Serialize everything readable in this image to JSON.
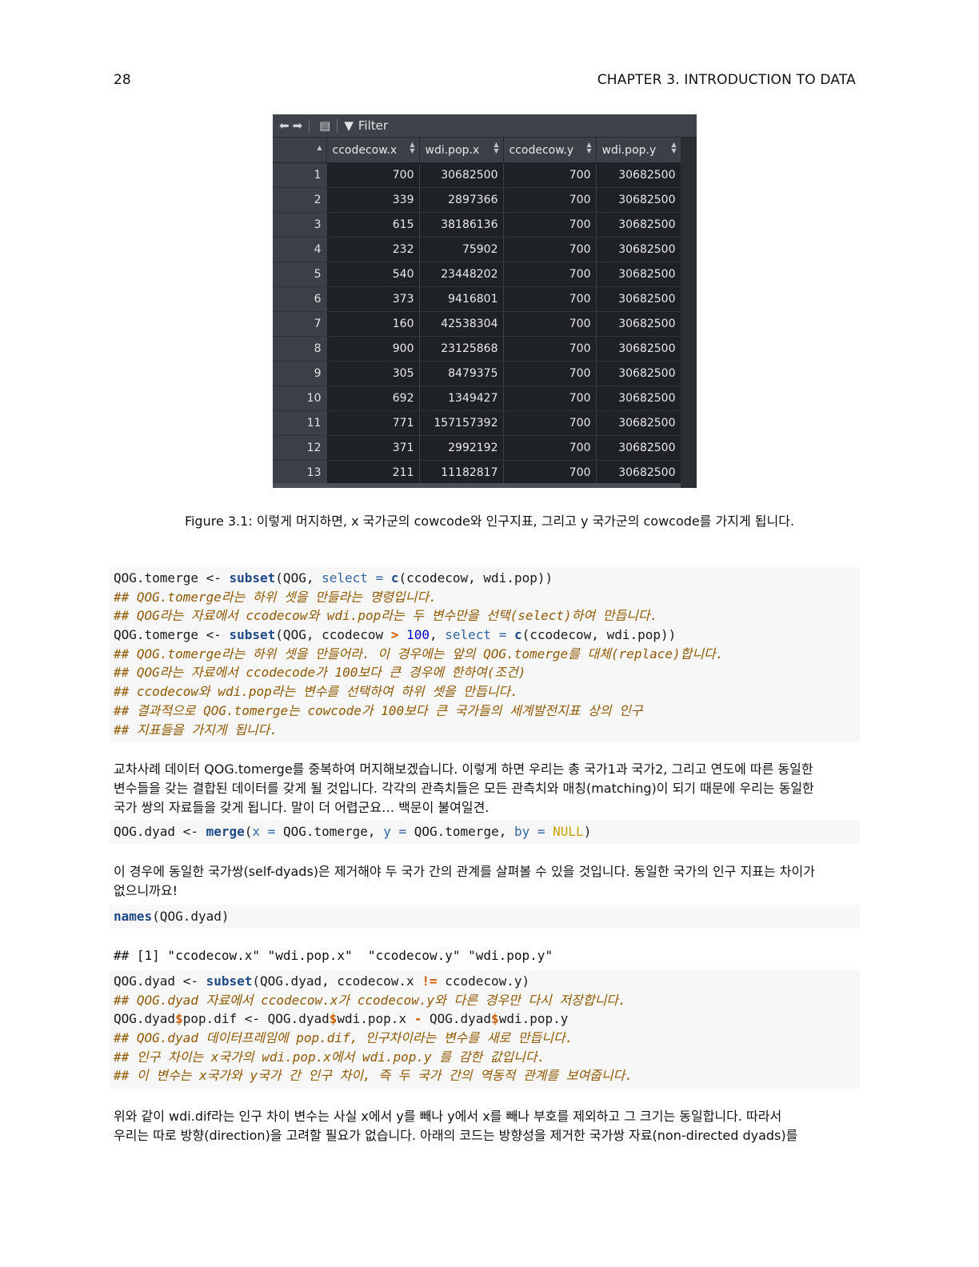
{
  "header": {
    "page_number": "28",
    "chapter": "CHAPTER 3.  INTRODUCTION TO DATA"
  },
  "viewer": {
    "filter_label": "Filter",
    "columns": [
      "ccodecow.x",
      "wdi.pop.x",
      "ccodecow.y",
      "wdi.pop.y"
    ],
    "rows": [
      [
        "1",
        "700",
        "30682500",
        "700",
        "30682500"
      ],
      [
        "2",
        "339",
        "2897366",
        "700",
        "30682500"
      ],
      [
        "3",
        "615",
        "38186136",
        "700",
        "30682500"
      ],
      [
        "4",
        "232",
        "75902",
        "700",
        "30682500"
      ],
      [
        "5",
        "540",
        "23448202",
        "700",
        "30682500"
      ],
      [
        "6",
        "373",
        "9416801",
        "700",
        "30682500"
      ],
      [
        "7",
        "160",
        "42538304",
        "700",
        "30682500"
      ],
      [
        "8",
        "900",
        "23125868",
        "700",
        "30682500"
      ],
      [
        "9",
        "305",
        "8479375",
        "700",
        "30682500"
      ],
      [
        "10",
        "692",
        "1349427",
        "700",
        "30682500"
      ],
      [
        "11",
        "771",
        "157157392",
        "700",
        "30682500"
      ],
      [
        "12",
        "371",
        "2992192",
        "700",
        "30682500"
      ],
      [
        "13",
        "211",
        "11182817",
        "700",
        "30682500"
      ]
    ]
  },
  "caption": "Figure 3.1: 이렇게 머지하면, x 국가군의 cowcode와 인구지표, 그리고 y 국가군의 cowcode를 가지게 됩니다.",
  "code1": {
    "l1": "QOG.tomerge <- subset(QOG, select = c(ccodecow, wdi.pop))",
    "l2": "## QOG.tomerge라는 하위 셋을 만들라는 명령입니다.",
    "l3": "## QOG라는 자료에서 ccodecow와 wdi.pop라는 두 변수만을 선택(select)하여 만듭니다.",
    "l4": "QOG.tomerge <- subset(QOG, ccodecow > 100, select = c(ccodecow, wdi.pop))",
    "l5": "## QOG.tomerge라는 하위 셋을 만들어라. 이 경우에는 앞의 QOG.tomerge를 대체(replace)합니다.",
    "l6": "## QOG라는 자료에서 ccodecode가 100보다 큰 경우에 한하여(조건)",
    "l7": "## ccodecow와 wdi.pop라는 변수를 선택하여 하위 셋을 만듭니다.",
    "l8": "## 결과적으로 QOG.tomerge는 cowcode가 100보다 큰 국가들의 세계발전지표 상의 인구",
    "l9": "## 지표들을 가지게 됩니다."
  },
  "para1": {
    "l1": "교차사례 데이터 QOG.tomerge를 중복하여 머지해보겠습니다. 이렇게 하면 우리는 총 국가1과 국가2, 그리고 연도에 따른 동일한",
    "l2": "변수들을 갖는 결합된 데이터를 갖게 될 것입니다. 각각의 관측치들은 모든 관측치와 매칭(matching)이 되기 때문에 우리는 동일한",
    "l3": "국가 쌍의 자료들을 갖게 됩니다. 말이 더 어렵군요… 백문이 불여일견."
  },
  "code2": "QOG.dyad <- merge(x = QOG.tomerge, y = QOG.tomerge, by = NULL)",
  "para2": {
    "l1": "이 경우에 동일한 국가쌍(self-dyads)은 제거해야 두 국가 간의 관계를 살펴볼 수 있을 것입니다. 동일한 국가의 인구 지표는 차이가",
    "l2": "없으니까요!"
  },
  "code3": "names(QOG.dyad)",
  "output1": "## [1] \"ccodecow.x\" \"wdi.pop.x\"  \"ccodecow.y\" \"wdi.pop.y\"",
  "code4": {
    "l1": "QOG.dyad <- subset(QOG.dyad, ccodecow.x != ccodecow.y)",
    "l2": "## QOG.dyad 자료에서 ccodecow.x가 ccodecow.y와 다른 경우만 다시 저장합니다.",
    "l3": "QOG.dyad$pop.dif <- QOG.dyad$wdi.pop.x - QOG.dyad$wdi.pop.y",
    "l4": "## QOG.dyad 데이터프레임에 pop.dif, 인구차이라는 변수를 새로 만듭니다.",
    "l5": "## 인구 차이는 x국가의 wdi.pop.x에서 wdi.pop.y 를 감한 값입니다.",
    "l6": "## 이 변수는 x국가와 y국가 간 인구 차이, 즉 두 국가 간의 역동적 관계를 보여줍니다."
  },
  "para3": {
    "l1": "위와 같이 wdi.dif라는 인구 차이 변수는 사실 x에서 y를 빼나 y에서 x를 빼나 부호를 제외하고 그 크기는 동일합니다. 따라서",
    "l2": "우리는 따로 방향(direction)을 고려할 필요가 없습니다. 아래의 코드는 방향성을 제거한 국가쌍 자료(non-directed dyads)를"
  }
}
